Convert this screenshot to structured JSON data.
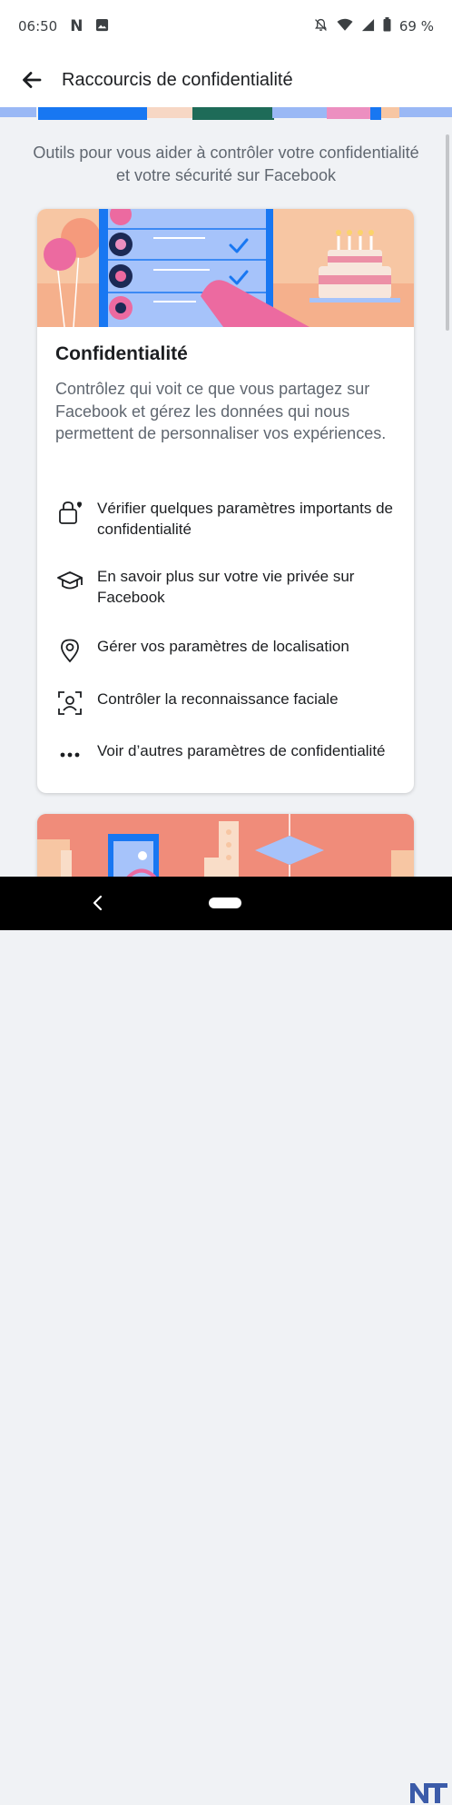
{
  "status_bar": {
    "time": "06:50",
    "notif_n": "N",
    "battery": "69 %",
    "icons": [
      "image-notification-icon",
      "bell-off-icon",
      "wifi-icon",
      "signal-icon",
      "battery-icon"
    ]
  },
  "header": {
    "title": "Raccourcis de confidentialité",
    "back_icon": "arrow-left-icon"
  },
  "page": {
    "subtitle": "Outils pour vous aider à contrôler votre confidentialité et votre sécurité sur Facebook"
  },
  "privacy_card": {
    "title": "Confidentialité",
    "description": "Contrôlez qui voit ce que vous partagez sur Facebook et gérez les données qui nous permettent de personnaliser vos expériences.",
    "options": [
      {
        "label": "Vérifier quelques paramètres importants de confidentialité",
        "icon": "lock-heart-icon"
      },
      {
        "label": "En savoir plus sur votre vie privée sur Facebook",
        "icon": "graduation-cap-icon"
      },
      {
        "label": "Gérer vos paramètres de localisation",
        "icon": "location-pin-icon"
      },
      {
        "label": "Contrôler la reconnaissance faciale",
        "icon": "face-scan-icon"
      },
      {
        "label": "Voir d’autres paramètres de confidentialité",
        "icon": "more-dots-icon"
      }
    ]
  },
  "nav_bar": {
    "back_icon": "nav-back-icon",
    "home_icon": "nav-home-pill"
  },
  "colors": {
    "accent_blue": "#1877f2",
    "peach": "#f7c6a3",
    "pink": "#ec6aa0",
    "coral": "#f08c7a",
    "text_secondary": "#606770"
  }
}
